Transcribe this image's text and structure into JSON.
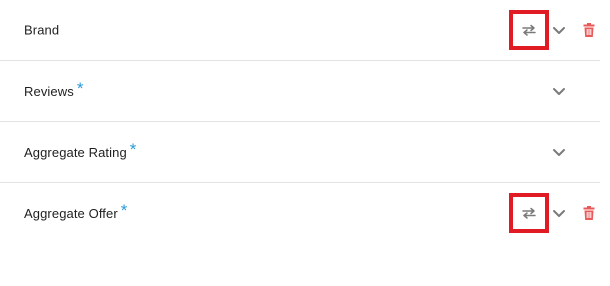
{
  "colors": {
    "text": "#1f1f1f",
    "required_asterisk": "#2b9ad6",
    "highlight_box": "#e01b24",
    "icon_gray": "#7a7a7a",
    "delete_red": "#e85a5a",
    "divider": "#e3e3e3"
  },
  "rows": [
    {
      "label": "Brand",
      "required": "",
      "icons": [
        "swap-icon",
        "chevron-down-icon",
        "trash-icon"
      ]
    },
    {
      "label": "Reviews",
      "required": "*",
      "icons": [
        "chevron-down-icon"
      ]
    },
    {
      "label": "Aggregate Rating",
      "required": "*",
      "icons": [
        "chevron-down-icon"
      ]
    },
    {
      "label": "Aggregate Offer",
      "required": "*",
      "icons": [
        "swap-icon",
        "chevron-down-icon",
        "trash-icon"
      ]
    }
  ]
}
